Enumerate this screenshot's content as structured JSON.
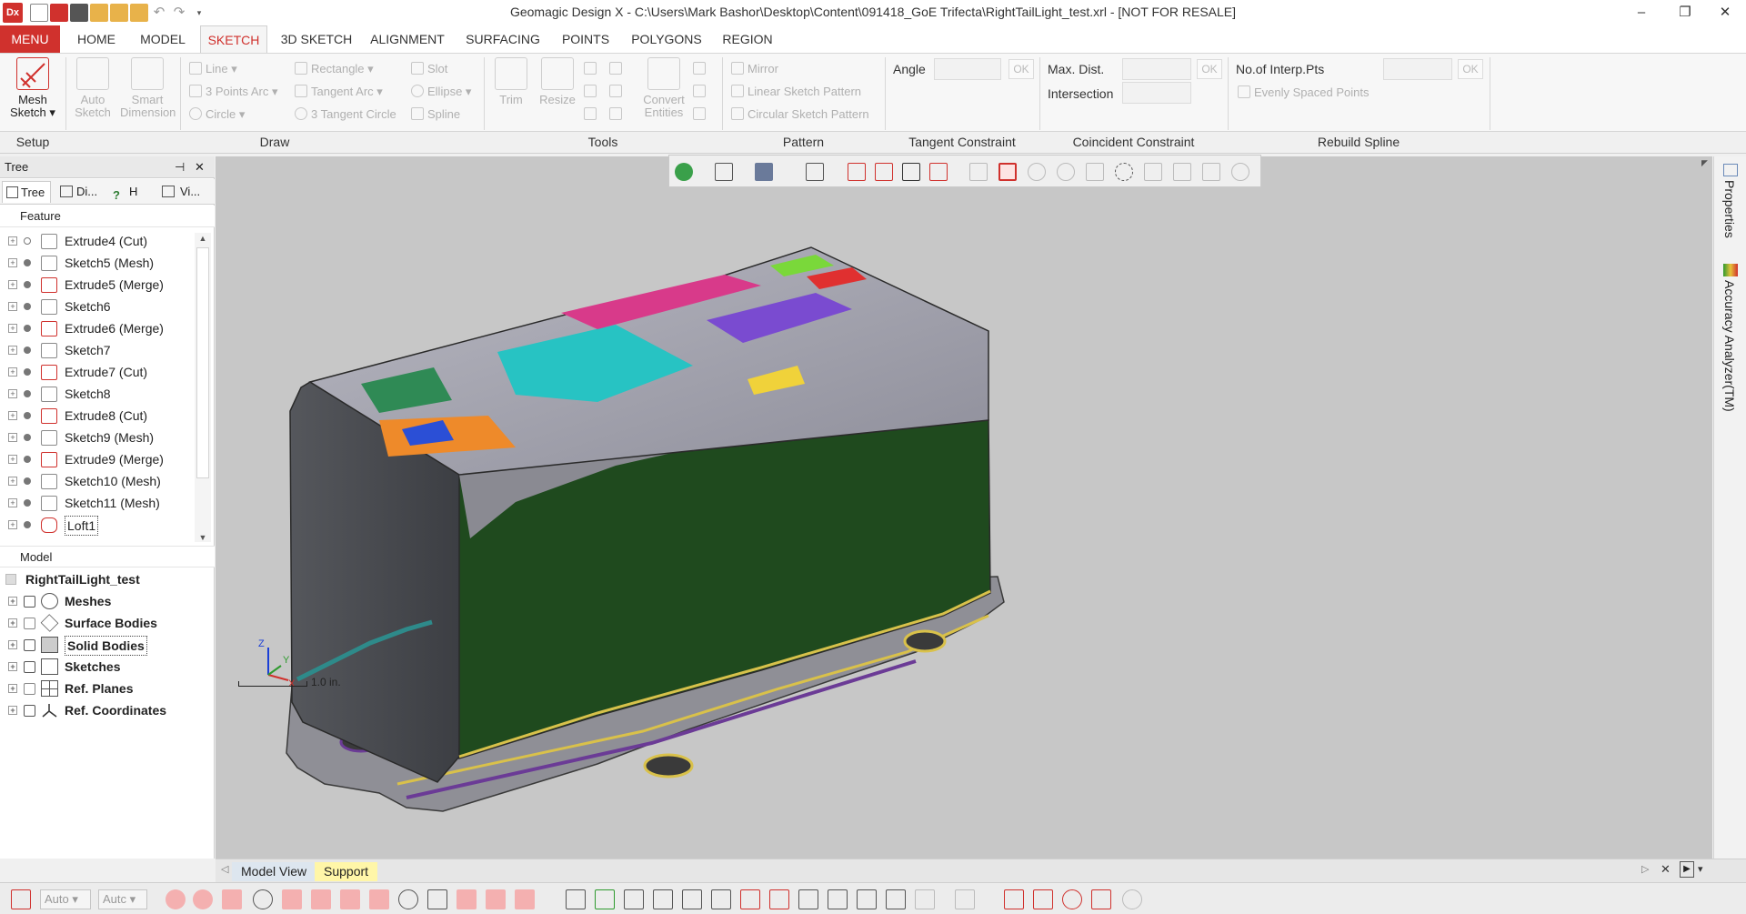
{
  "window": {
    "title": "Geomagic Design X - C:\\Users\\Mark Bashor\\Desktop\\Content\\091418_GoE Trifecta\\RightTailLight_test.xrl - [NOT FOR RESALE]",
    "app_icon": "Dx",
    "minimize": "–",
    "restore": "❐",
    "close": "✕"
  },
  "ribbon_tabs": [
    "MENU",
    "HOME",
    "MODEL",
    "SKETCH",
    "3D SKETCH",
    "ALIGNMENT",
    "SURFACING",
    "POINTS",
    "POLYGONS",
    "REGION"
  ],
  "active_tab": "SKETCH",
  "ribbon": {
    "setup": {
      "mesh_sketch": "Mesh Sketch"
    },
    "draw": {
      "auto_sketch": "Auto Sketch",
      "smart_dimension": "Smart Dimension",
      "line": "Line",
      "three_points_arc": "3 Points Arc",
      "circle": "Circle",
      "rectangle": "Rectangle",
      "tangent_arc": "Tangent Arc",
      "three_tangent_circle": "3 Tangent Circle",
      "slot": "Slot",
      "ellipse": "Ellipse",
      "spline": "Spline"
    },
    "tools": {
      "trim": "Trim",
      "resize": "Resize",
      "convert_entities": "Convert Entities"
    },
    "pattern": {
      "mirror": "Mirror",
      "linear": "Linear Sketch Pattern",
      "circular": "Circular Sketch Pattern"
    },
    "tangent_constraint": {
      "angle_label": "Angle",
      "ok": "OK"
    },
    "coincident_constraint": {
      "max_dist_label": "Max. Dist.",
      "intersection_label": "Intersection",
      "ok": "OK"
    },
    "rebuild_spline": {
      "interp_label": "No.of Interp.Pts",
      "evenly_spaced": "Evenly Spaced Points",
      "ok": "OK"
    },
    "group_labels": [
      "Setup",
      "Draw",
      "Tools",
      "Pattern",
      "Tangent Constraint",
      "Coincident Constraint",
      "Rebuild Spline"
    ]
  },
  "tree_panel": {
    "header": "Tree",
    "pin": "⊣",
    "close": "✕",
    "tabs": [
      "Tree",
      "Di...",
      "H",
      "Vi..."
    ],
    "feature_header": "Feature",
    "features": [
      "Extrude4 (Cut)",
      "Sketch5 (Mesh)",
      "Extrude5 (Merge)",
      "Sketch6",
      "Extrude6 (Merge)",
      "Sketch7",
      "Extrude7 (Cut)",
      "Sketch8",
      "Extrude8 (Cut)",
      "Sketch9 (Mesh)",
      "Extrude9 (Merge)",
      "Sketch10 (Mesh)",
      "Sketch11 (Mesh)",
      "Loft1"
    ],
    "model_header": "Model",
    "model_root": "RightTailLight_test",
    "model_items": [
      "Meshes",
      "Surface Bodies",
      "Solid Bodies",
      "Sketches",
      "Ref. Planes",
      "Ref. Coordinates"
    ]
  },
  "viewport": {
    "scale_label": "1.0 in.",
    "axes": {
      "z": "Z",
      "y": "Y",
      "x": "X"
    }
  },
  "side_tabs": [
    "Properties",
    "Accuracy Analyzer(TM)"
  ],
  "bottom_tabs": [
    "Model View",
    "Support"
  ],
  "status": {
    "combo1": "Auto",
    "combo2": "Autc"
  },
  "colors": {
    "accent": "#d0312d",
    "support_tab": "#fff6a8",
    "viewport_bg": "#c7c7c7",
    "part_dark": "#4b4d52",
    "part_green": "#1f4a1e"
  }
}
